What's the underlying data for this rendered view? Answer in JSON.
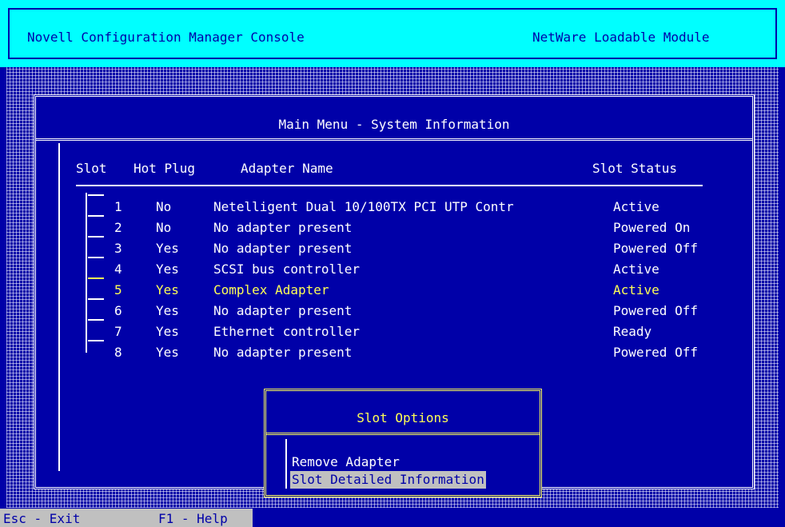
{
  "header": {
    "title": "Novell Configuration Manager Console",
    "module": "NetWare Loadable Module"
  },
  "main": {
    "title": "Main Menu - System Information",
    "columns": [
      "Slot",
      "Hot Plug",
      "Adapter Name",
      "Slot Status"
    ],
    "rows": [
      {
        "slot": "1",
        "hot_plug": "No",
        "adapter": "Netelligent Dual 10/100TX PCI UTP Contr",
        "status": "Active"
      },
      {
        "slot": "2",
        "hot_plug": "No",
        "adapter": "No adapter present",
        "status": "Powered On"
      },
      {
        "slot": "3",
        "hot_plug": "Yes",
        "adapter": "No adapter present",
        "status": "Powered Off"
      },
      {
        "slot": "4",
        "hot_plug": "Yes",
        "adapter": "SCSI bus controller",
        "status": "Active"
      },
      {
        "slot": "5",
        "hot_plug": "Yes",
        "adapter": "Complex Adapter",
        "status": "Active"
      },
      {
        "slot": "6",
        "hot_plug": "Yes",
        "adapter": "No adapter present",
        "status": "Powered Off"
      },
      {
        "slot": "7",
        "hot_plug": "Yes",
        "adapter": "Ethernet controller",
        "status": "Ready"
      },
      {
        "slot": "8",
        "hot_plug": "Yes",
        "adapter": "No adapter present",
        "status": "Powered Off"
      }
    ],
    "selected_slot": "5"
  },
  "popup": {
    "title": "Slot Options",
    "options": [
      "Remove Adapter",
      "Slot Detailed Information"
    ],
    "highlighted": "Slot Detailed Information"
  },
  "footer": {
    "exit": "Esc - Exit",
    "help": "F1 - Help"
  },
  "colors": {
    "background": "#0000a8",
    "header": "#00ffff",
    "selected_text": "#ffff55",
    "highlight": "#c0c0c0"
  }
}
